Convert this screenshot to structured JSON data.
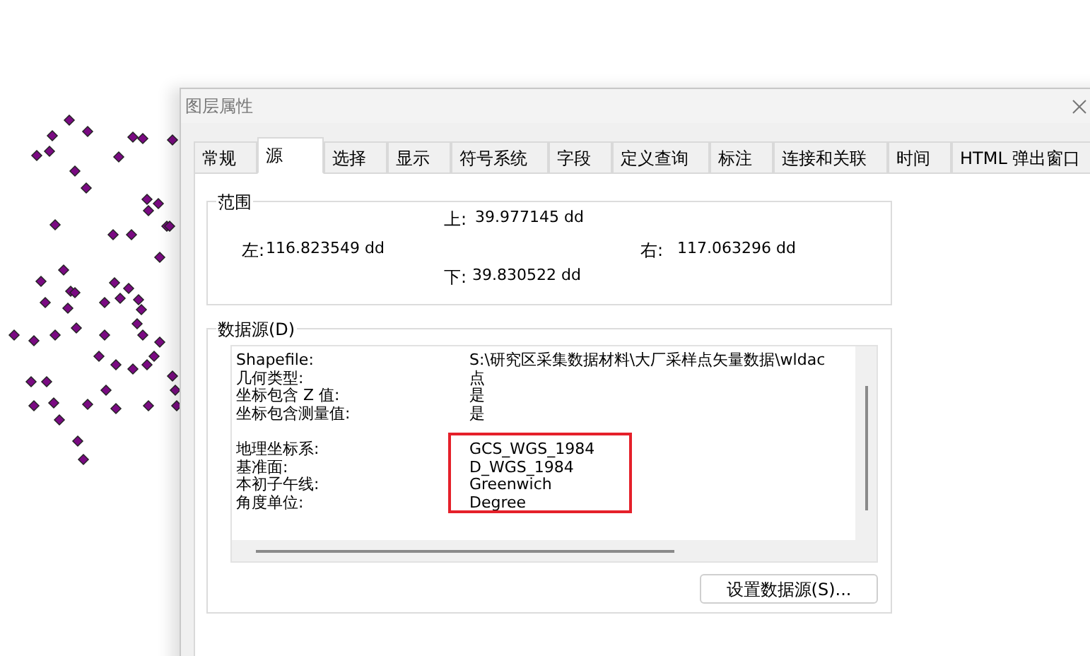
{
  "dialog": {
    "title": "图层属性"
  },
  "tabs": [
    {
      "label": "常规",
      "selected": false
    },
    {
      "label": "源",
      "selected": true
    },
    {
      "label": "选择",
      "selected": false
    },
    {
      "label": "显示",
      "selected": false
    },
    {
      "label": "符号系统",
      "selected": false
    },
    {
      "label": "字段",
      "selected": false
    },
    {
      "label": "定义查询",
      "selected": false
    },
    {
      "label": "标注",
      "selected": false
    },
    {
      "label": "连接和关联",
      "selected": false
    },
    {
      "label": "时间",
      "selected": false
    },
    {
      "label": "HTML 弹出窗口",
      "selected": false
    }
  ],
  "extent": {
    "title": "范围",
    "top": {
      "label": "上:",
      "value": "39.977145 dd"
    },
    "left": {
      "label": "左:",
      "value": "116.823549 dd"
    },
    "right": {
      "label": "右:",
      "value": "117.063296 dd"
    },
    "bottom": {
      "label": "下:",
      "value": "39.830522 dd"
    }
  },
  "data_source": {
    "title": "数据源(D)",
    "sections": [
      {
        "highlighted": false,
        "rows": [
          {
            "label": "Shapefile:",
            "value": "S:\\研究区采集数据材料\\大厂采样点矢量数据\\wldac"
          },
          {
            "label": "几何类型:",
            "value": "点"
          },
          {
            "label": "坐标包含 Z 值:",
            "value": "是"
          },
          {
            "label": "坐标包含测量值:",
            "value": "是"
          }
        ]
      },
      {
        "highlighted": true,
        "rows": [
          {
            "label": "地理坐标系:",
            "value": "GCS_WGS_1984"
          },
          {
            "label": "基准面:",
            "value": "D_WGS_1984"
          },
          {
            "label": "本初子午线:",
            "value": "Greenwich"
          },
          {
            "label": "角度单位:",
            "value": "Degree"
          }
        ]
      }
    ],
    "button": "设置数据源(S)..."
  }
}
